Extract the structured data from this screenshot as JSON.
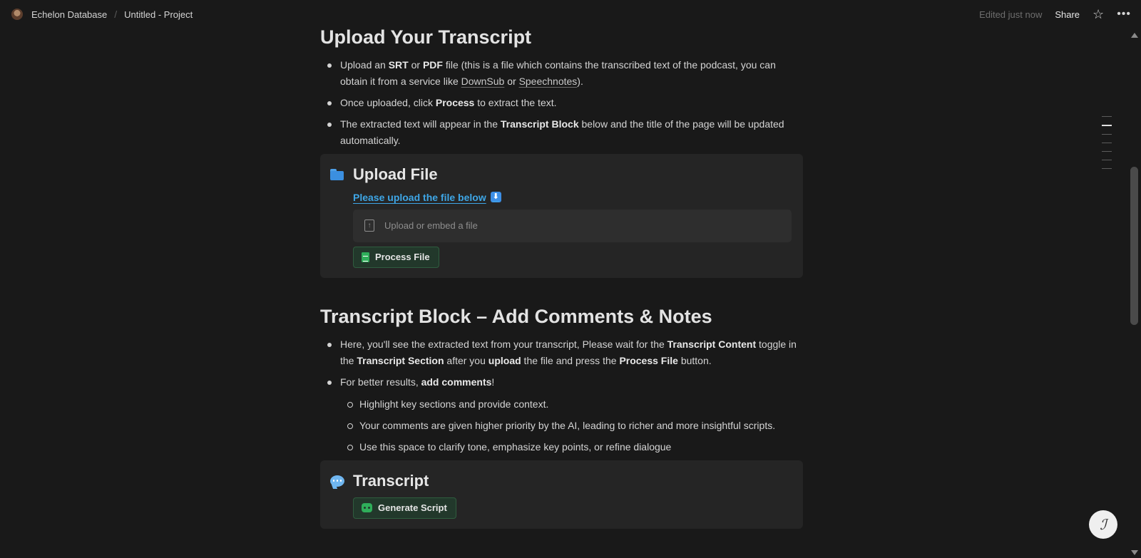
{
  "topbar": {
    "workspace": "Echelon Database",
    "separator": "/",
    "page": "Untitled - Project",
    "edited": "Edited just now",
    "share": "Share",
    "star_icon": "star-icon",
    "more_icon": "more-icon"
  },
  "section1": {
    "heading": "Upload Your Transcript",
    "b1": {
      "t1": "Upload an ",
      "srt": "SRT",
      "t2": " or ",
      "pdf": "PDF",
      "t3": " file (this is a file which contains the transcribed text of the podcast, you can obtain it from a service like ",
      "link1": "DownSub",
      "t4": " or ",
      "link2": "Speechnotes",
      "t5": ")."
    },
    "b2": {
      "t1": "Once uploaded, click ",
      "process": "Process",
      "t2": " to extract the text."
    },
    "b3": {
      "t1": "The extracted text will appear in the ",
      "block": "Transcript Block",
      "t2": " below and the title of the page will be updated automatically."
    }
  },
  "upload_card": {
    "title": "Upload File",
    "link": "Please upload the file below",
    "upload_placeholder": "Upload or embed a file",
    "button": "Process File"
  },
  "section2": {
    "heading": "Transcript Block – Add Comments & Notes",
    "b1": {
      "t1": "Here, you'll see the extracted text from your transcript, Please wait for the ",
      "content": "Transcript Content",
      "t2": " toggle in the ",
      "section": "Transcript Section",
      "t3": " after you ",
      "upload": "upload",
      "t4": " the file and press the ",
      "pf": "Process File",
      "t5": " button."
    },
    "b2": {
      "t1": "For better results, ",
      "add": "add comments",
      "t2": "!"
    },
    "sub": [
      "Highlight key sections and provide context.",
      "Your comments are given higher priority by the AI, leading to richer and more insightful scripts.",
      "Use this space to clarify tone, emphasize key points, or refine dialogue"
    ]
  },
  "transcript_card": {
    "title": "Transcript",
    "button": "Generate Script"
  }
}
